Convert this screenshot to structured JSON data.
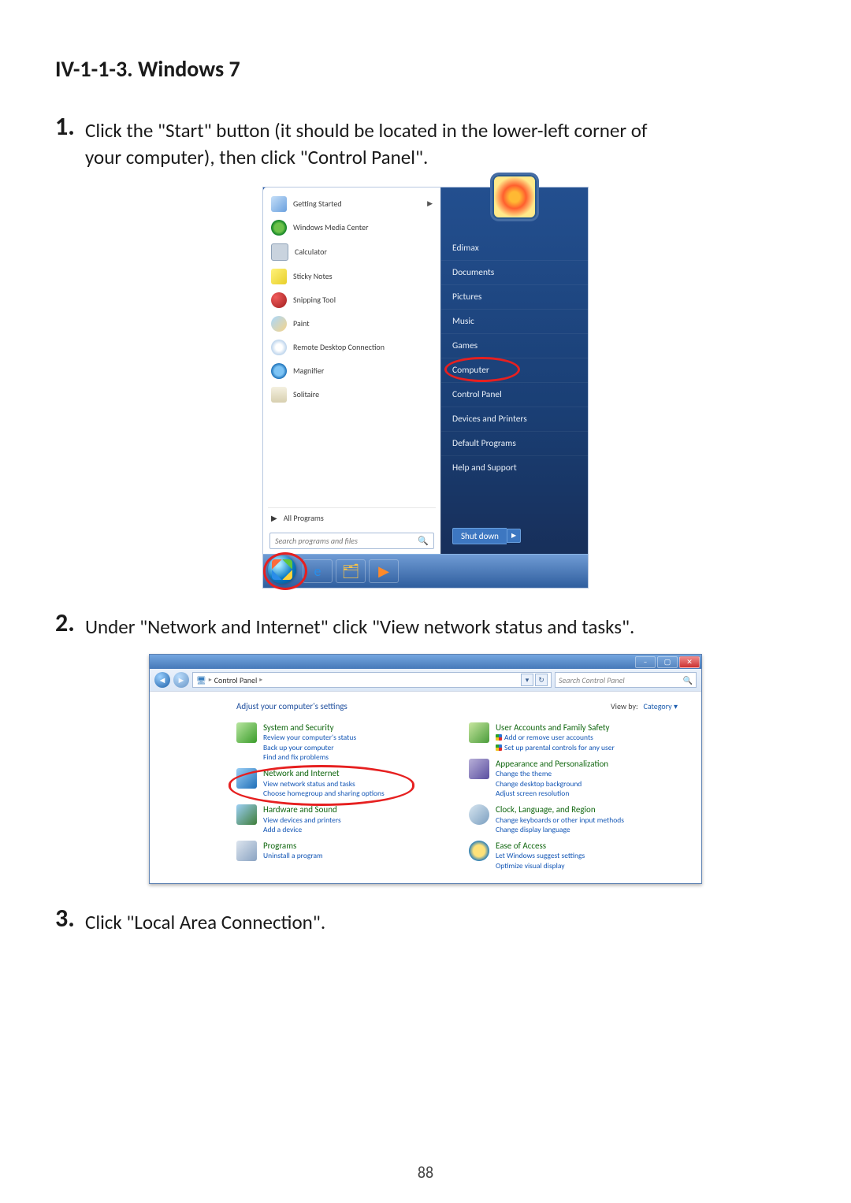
{
  "heading": "IV-1-1-3.   Windows 7",
  "steps": [
    {
      "num": "1.",
      "text_a": "Click the \"Start\" button (it should be located in the lower-left corner of",
      "text_b": "your computer), then click \"Control Panel\"."
    },
    {
      "num": "2.",
      "text_a": "Under \"Network and Internet\" click \"View network status and tasks\"."
    },
    {
      "num": "3.",
      "text_a": "Click \"Local Area Connection\"."
    }
  ],
  "start_menu": {
    "search_placeholder": "Search programs and files",
    "all_programs": "All Programs",
    "programs": [
      {
        "label": "Getting Started",
        "has_arrow": true,
        "ico": "getting"
      },
      {
        "label": "Windows Media Center",
        "ico": "wmc"
      },
      {
        "label": "Calculator",
        "ico": "calc"
      },
      {
        "label": "Sticky Notes",
        "ico": "sticky"
      },
      {
        "label": "Snipping Tool",
        "ico": "snip"
      },
      {
        "label": "Paint",
        "ico": "paint"
      },
      {
        "label": "Remote Desktop Connection",
        "ico": "rdc"
      },
      {
        "label": "Magnifier",
        "ico": "mag"
      },
      {
        "label": "Solitaire",
        "ico": "sol"
      }
    ],
    "user_name": "Edimax",
    "right_items": [
      "Documents",
      "Pictures",
      "Music",
      "Games",
      "Computer",
      "Control Panel",
      "Devices and Printers",
      "Default Programs",
      "Help and Support"
    ],
    "shutdown": "Shut down"
  },
  "control_panel": {
    "breadcrumb_root": "Control Panel",
    "search_placeholder": "Search Control Panel",
    "adjust_label": "Adjust your computer's settings",
    "view_by_label": "View by:",
    "view_by_value": "Category ▾",
    "left": [
      {
        "h": "System and Security",
        "subs": [
          "Review your computer's status",
          "Back up your computer",
          "Find and fix problems"
        ],
        "ico": "sec"
      },
      {
        "h": "Network and Internet",
        "subs": [
          "View network status and tasks",
          "Choose homegroup and sharing options"
        ],
        "ico": "net",
        "circled": true
      },
      {
        "h": "Hardware and Sound",
        "subs": [
          "View devices and printers",
          "Add a device"
        ],
        "ico": "hw"
      },
      {
        "h": "Programs",
        "subs": [
          "Uninstall a program"
        ],
        "ico": "prog"
      }
    ],
    "right": [
      {
        "h": "User Accounts and Family Safety",
        "subs": [
          "Add or remove user accounts",
          "Set up parental controls for any user"
        ],
        "ico": "user",
        "shield": [
          0,
          1
        ]
      },
      {
        "h": "Appearance and Personalization",
        "subs": [
          "Change the theme",
          "Change desktop background",
          "Adjust screen resolution"
        ],
        "ico": "appr"
      },
      {
        "h": "Clock, Language, and Region",
        "subs": [
          "Change keyboards or other input methods",
          "Change display language"
        ],
        "ico": "clk"
      },
      {
        "h": "Ease of Access",
        "subs": [
          "Let Windows suggest settings",
          "Optimize visual display"
        ],
        "ico": "ease"
      }
    ]
  },
  "page_number": "88"
}
